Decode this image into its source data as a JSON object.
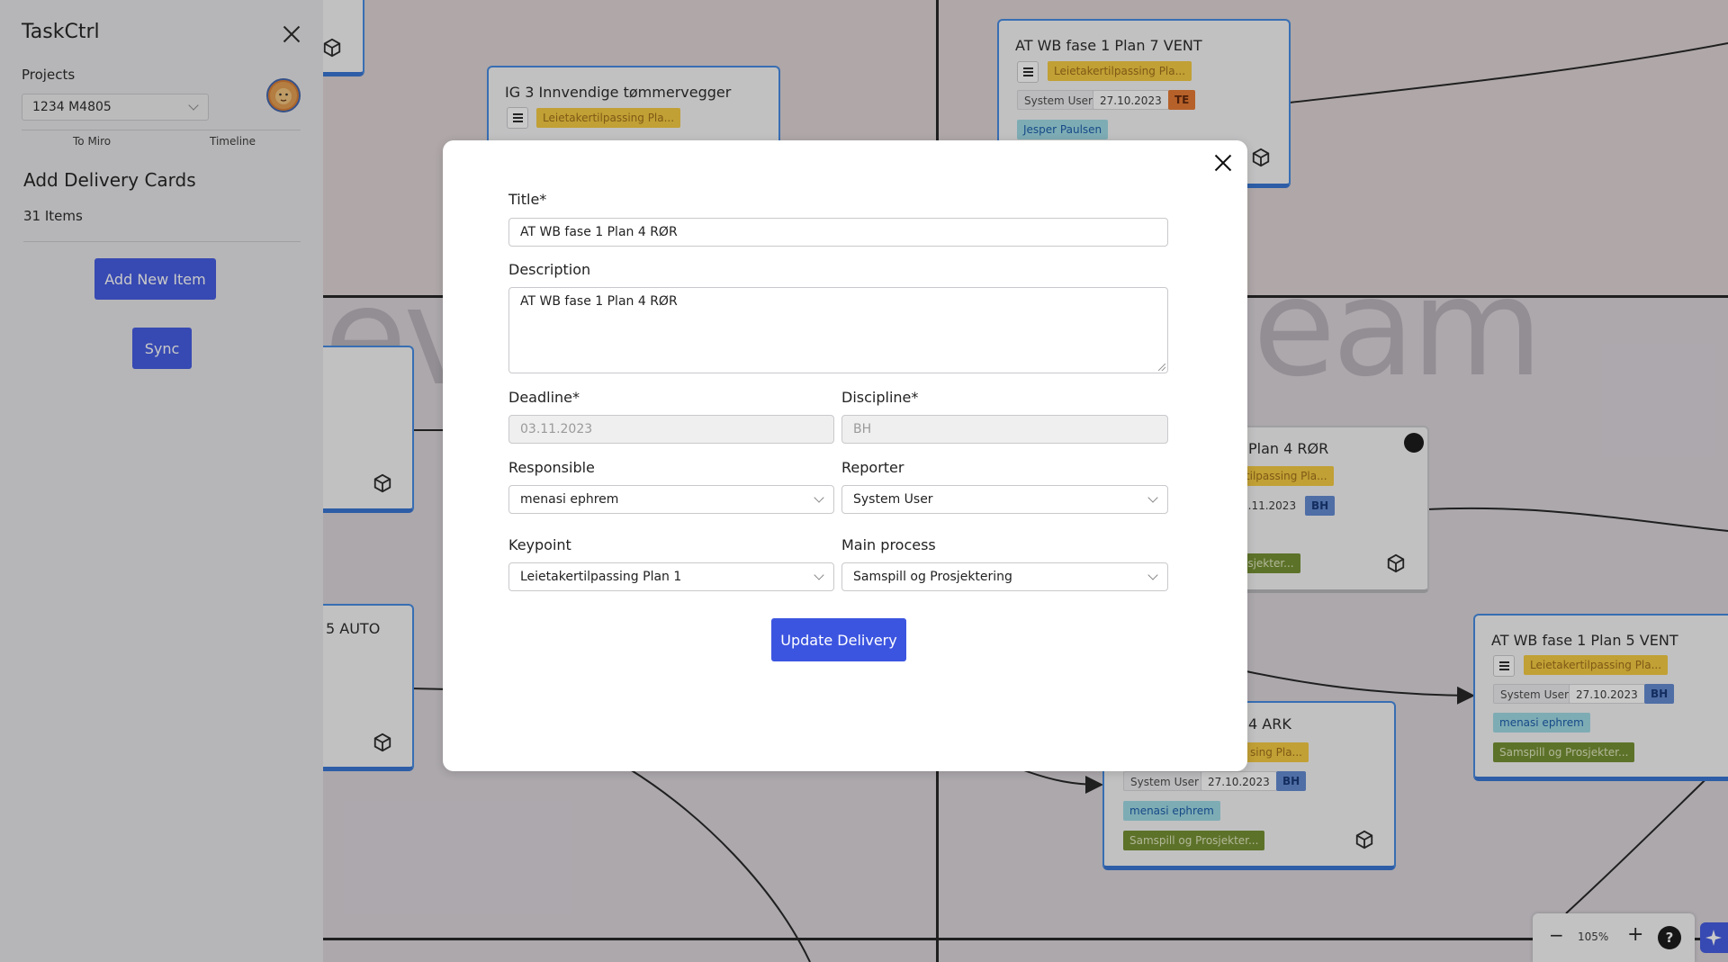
{
  "sidebar": {
    "app_title": "TaskCtrl",
    "projects_label": "Projects",
    "project_selected": "1234 M4805",
    "tabs": [
      {
        "label": "To Miro"
      },
      {
        "label": "Timeline"
      }
    ],
    "section_title": "Add Delivery Cards",
    "items_count": "31 Items",
    "add_new_label": "Add New Item",
    "sync_label": "Sync"
  },
  "board": {
    "background_words": [
      "ev",
      "eam"
    ],
    "cards": [
      {
        "title": "IG 3 Innvendige tømmervegger",
        "keypoint": "Leietakertilpassing Pla..."
      },
      {
        "title": "AT WB fase 1 Plan 7 VENT",
        "keypoint": "Leietakertilpassing Pla...",
        "reporter": "System User",
        "date": "27.10.2023",
        "discipline": "TE",
        "responsible": "Jesper Paulsen"
      },
      {
        "title": "Plan 4 RØR",
        "keypoint": "rtilpassing Pla...",
        "date": "3.11.2023",
        "discipline": "BH",
        "process": "osjekter..."
      },
      {
        "title": "5  AUTO"
      },
      {
        "title": "4 ARK",
        "keypoint": "sing Pla...",
        "reporter": "System User",
        "date": "27.10.2023",
        "discipline": "BH",
        "responsible": "menasi ephrem",
        "process": "Samspill og Prosjekter..."
      },
      {
        "title": "AT WB fase 1 Plan 5 VENT",
        "keypoint": "Leietakertilpassing Pla...",
        "reporter": "System User",
        "date": "27.10.2023",
        "discipline": "BH",
        "responsible": "menasi ephrem",
        "process": "Samspill og Prosjekter..."
      }
    ]
  },
  "modal": {
    "title_label": "Title*",
    "title_value": "AT WB fase 1 Plan 4 RØR",
    "description_label": "Description",
    "description_value": "AT WB fase 1 Plan 4 RØR",
    "deadline_label": "Deadline*",
    "deadline_value": "03.11.2023",
    "discipline_label": "Discipline*",
    "discipline_value": "BH",
    "responsible_label": "Responsible",
    "responsible_value": "menasi ephrem",
    "reporter_label": "Reporter",
    "reporter_value": "System User",
    "keypoint_label": "Keypoint",
    "keypoint_value": "Leietakertilpassing Plan 1",
    "main_process_label": "Main process",
    "main_process_value": "Samspill og Prosjektering",
    "submit_label": "Update Delivery"
  },
  "zoom": {
    "level": "105%",
    "minus": "−",
    "plus": "+",
    "help": "?"
  },
  "colors": {
    "primary": "#3c55e0",
    "card_border": "#3e86e0",
    "keypoint_chip": "#f4c93a",
    "discipline_bh": "#5d86d0",
    "discipline_te": "#e6742a",
    "process_chip": "#6f8b2a",
    "person_chip": "#9bd9e3"
  }
}
